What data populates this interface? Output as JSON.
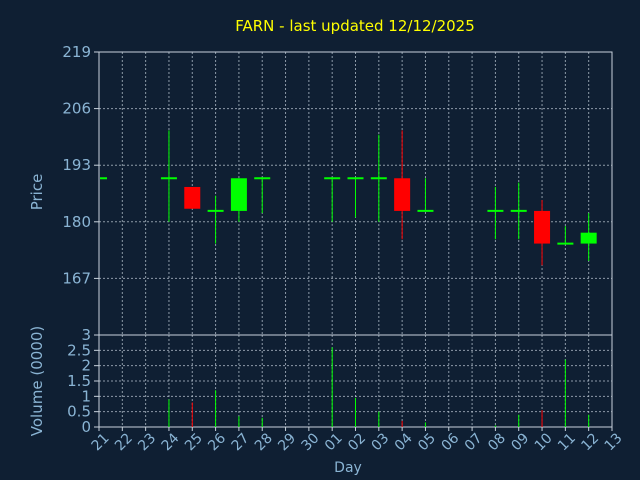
{
  "chart_data": {
    "type": "candlestick",
    "title": "FARN - last updated 12/12/2025",
    "xlabel": "Day",
    "price_panel": {
      "ylabel": "Price",
      "ylim": [
        154,
        219
      ],
      "yticks": [
        "219",
        "206",
        "193",
        "180",
        "167"
      ]
    },
    "volume_panel": {
      "ylabel": "Volume (0000)",
      "ylim": [
        0,
        3
      ],
      "yticks": [
        "3",
        "2.5",
        "2",
        "1.5",
        "1",
        "0.5",
        "0"
      ]
    },
    "x_tick_labels": [
      "21",
      "22",
      "23",
      "24",
      "25",
      "26",
      "27",
      "28",
      "29",
      "30",
      "01",
      "02",
      "03",
      "04",
      "05",
      "06",
      "07",
      "08",
      "09",
      "10",
      "11",
      "12",
      "13"
    ],
    "candles": [
      {
        "day": "21",
        "open": 190,
        "high": 190,
        "low": 190,
        "close": 190,
        "volume": 0
      },
      {
        "day": "24",
        "open": 190,
        "high": 201,
        "low": 180,
        "close": 190,
        "volume": 0.9
      },
      {
        "day": "25",
        "open": 188,
        "high": 188,
        "low": 183,
        "close": 183,
        "volume": 0.8
      },
      {
        "day": "26",
        "open": 182.5,
        "high": 186,
        "low": 175,
        "close": 182.5,
        "volume": 1.2
      },
      {
        "day": "27",
        "open": 182.5,
        "high": 190,
        "low": 180,
        "close": 190,
        "volume": 0.35
      },
      {
        "day": "28",
        "open": 190,
        "high": 190,
        "low": 182,
        "close": 190,
        "volume": 0.3
      },
      {
        "day": "01",
        "open": 190,
        "high": 190,
        "low": 180,
        "close": 190,
        "volume": 2.6
      },
      {
        "day": "02",
        "open": 190,
        "high": 190,
        "low": 181,
        "close": 190,
        "volume": 0.95
      },
      {
        "day": "03",
        "open": 190,
        "high": 200,
        "low": 180,
        "close": 190,
        "volume": 0.5
      },
      {
        "day": "04",
        "open": 190,
        "high": 201,
        "low": 176,
        "close": 182.5,
        "volume": 0.2
      },
      {
        "day": "05",
        "open": 182.5,
        "high": 190,
        "low": 182.5,
        "close": 182.5,
        "volume": 0.15
      },
      {
        "day": "08",
        "open": 182.5,
        "high": 188,
        "low": 176,
        "close": 182.5,
        "volume": 0.05
      },
      {
        "day": "09",
        "open": 182.5,
        "high": 189,
        "low": 176,
        "close": 182.5,
        "volume": 0.4
      },
      {
        "day": "10",
        "open": 182.5,
        "high": 185,
        "low": 170,
        "close": 175,
        "volume": 0.55
      },
      {
        "day": "11",
        "open": 175,
        "high": 179,
        "low": 175,
        "close": 175,
        "volume": 2.2
      },
      {
        "day": "12",
        "open": 175,
        "high": 182,
        "low": 171,
        "close": 177.5,
        "volume": 0.4
      }
    ],
    "grid": true,
    "colors": {
      "background": "#0f1f33",
      "title": "#ffff00",
      "axis_text": "#8ab4d4",
      "frame": "#c8d2dc",
      "grid": "#b8c4d0",
      "up": "#00ff00",
      "down": "#ff0000",
      "flat": "#00ff00"
    }
  }
}
